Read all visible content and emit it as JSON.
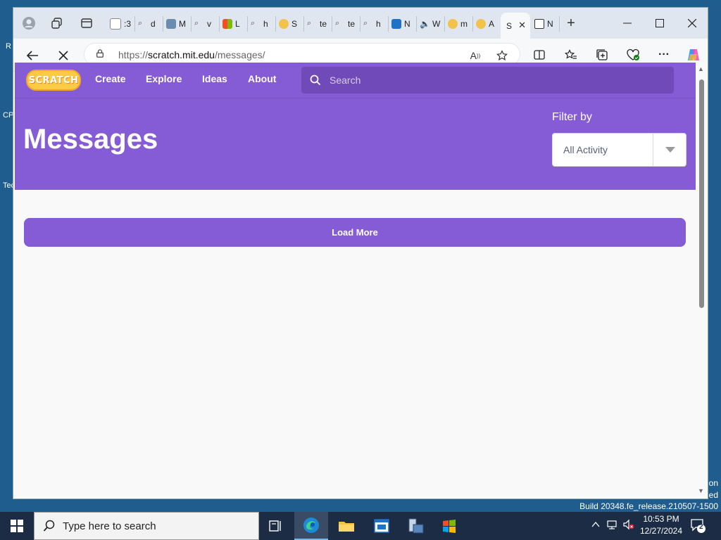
{
  "desktop": {
    "fragments": [
      "R",
      "CP",
      "Tec"
    ],
    "watermark_lines": [
      "on",
      "ed",
      "Build 20348.fe_release.210507-1500"
    ]
  },
  "browser": {
    "tabs": [
      {
        "letter": ":3",
        "color": "#9aa7b8"
      },
      {
        "letter": "d",
        "color": "#7d8b9c"
      },
      {
        "letter": "M",
        "color": "#6b8bb0"
      },
      {
        "letter": "v",
        "color": "#7d8b9c"
      },
      {
        "letter": "L",
        "color": "#f2b01e"
      },
      {
        "letter": "h",
        "color": "#7d8b9c"
      },
      {
        "letter": "S",
        "color": "#f2c24a"
      },
      {
        "letter": "te",
        "color": "#7d8b9c"
      },
      {
        "letter": "te",
        "color": "#7d8b9c"
      },
      {
        "letter": "h",
        "color": "#7d8b9c"
      },
      {
        "letter": "N",
        "color": "#1e72c8"
      },
      {
        "letter": "W",
        "color": "#444444"
      },
      {
        "letter": "m",
        "color": "#f2c24a"
      },
      {
        "letter": "A",
        "color": "#f2c24a"
      }
    ],
    "active_tab": {
      "letter": "S"
    },
    "last_tab": {
      "letter": "N"
    },
    "address": {
      "url_proto": "https://",
      "url_host": "scratch.mit.edu",
      "url_path": "/messages/"
    }
  },
  "scratch": {
    "logo_text": "SCRATCH",
    "nav": {
      "create": "Create",
      "explore": "Explore",
      "ideas": "Ideas",
      "about": "About"
    },
    "search_placeholder": "Search",
    "page_title": "Messages",
    "filter_label": "Filter by",
    "filter_value": "All Activity",
    "load_more": "Load More"
  },
  "taskbar": {
    "search_placeholder": "Type here to search",
    "time": "10:53 PM",
    "date": "12/27/2024",
    "notifications": "2"
  },
  "colors": {
    "scratch_purple": "#855cd6",
    "scratch_purple_dark": "#6f4ab8",
    "taskbar_bg": "#1c2c44"
  }
}
